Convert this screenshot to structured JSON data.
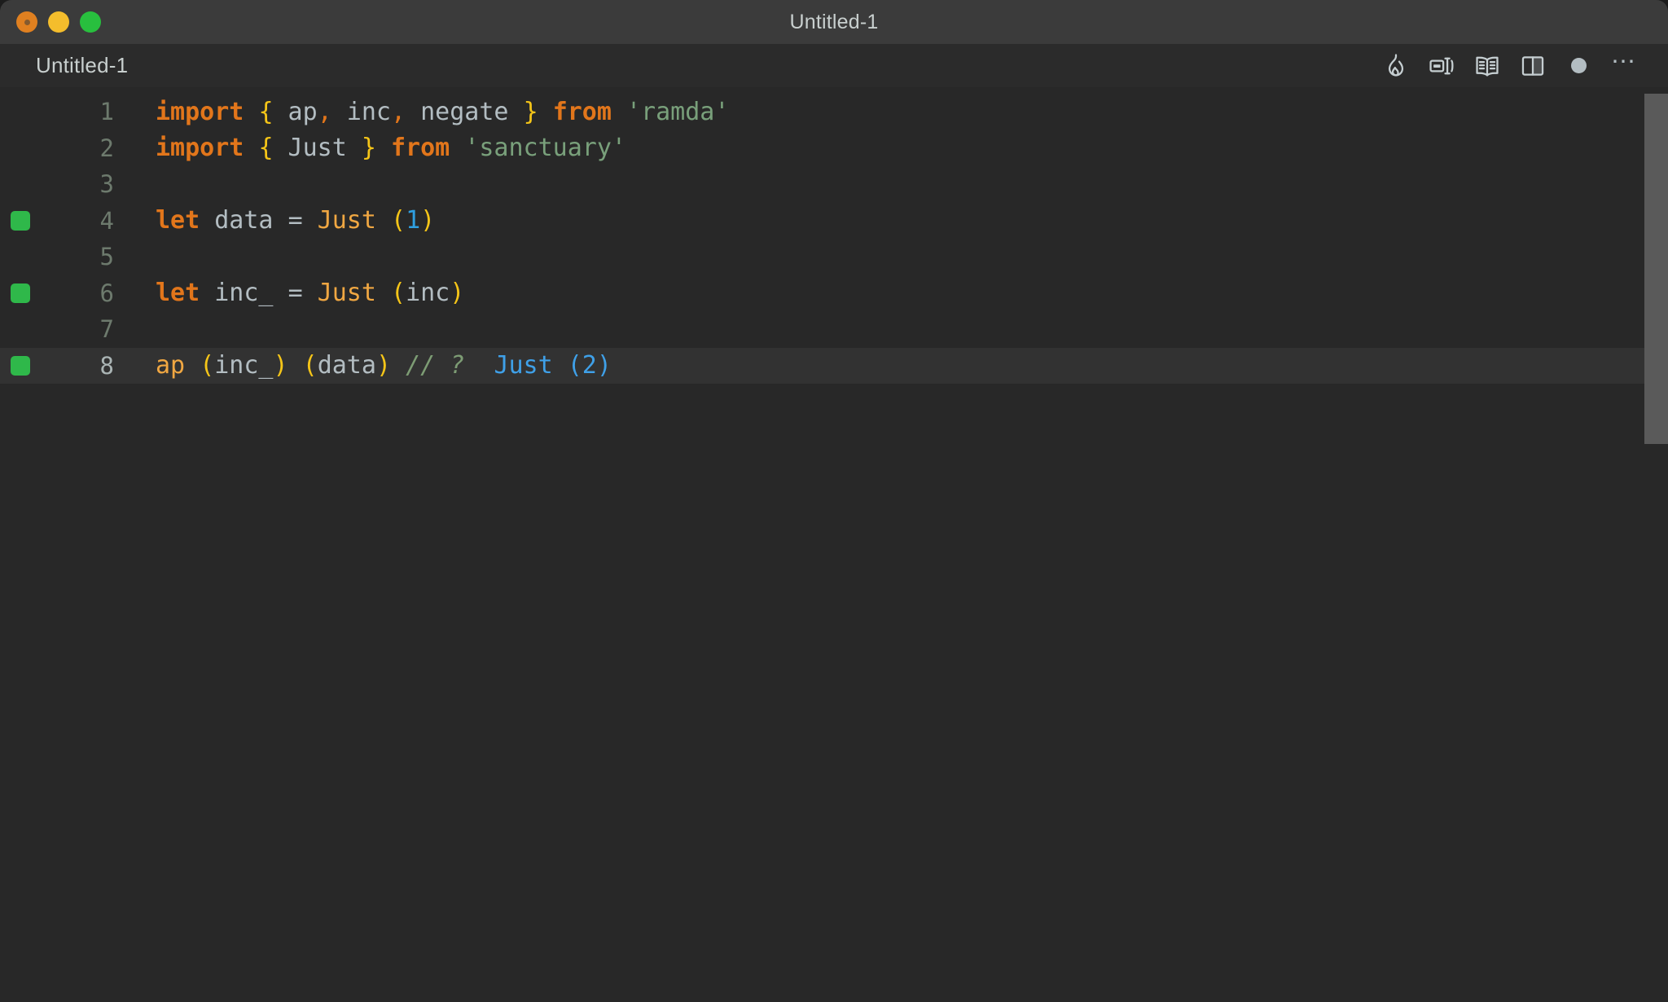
{
  "window": {
    "title": "Untitled-1",
    "traffic_lights": [
      {
        "name": "close-button",
        "color": "#e08020"
      },
      {
        "name": "minimize-button",
        "color": "#f4bd2c"
      },
      {
        "name": "zoom-button",
        "color": "#28bf3e"
      }
    ]
  },
  "tabbar": {
    "tab_label": "Untitled-1",
    "tools": [
      {
        "name": "flame-icon",
        "label": "Quokka / Run"
      },
      {
        "name": "rename-icon",
        "label": "Rename Symbol"
      },
      {
        "name": "book-icon",
        "label": "Open Docs"
      },
      {
        "name": "split-editor-icon",
        "label": "Split Editor"
      },
      {
        "name": "status-dot-icon",
        "label": "Unsaved changes"
      },
      {
        "name": "more-actions-icon",
        "label": "More Actions"
      }
    ]
  },
  "editor": {
    "language": "javascript",
    "active_line": 8,
    "lines": [
      {
        "number": "1",
        "marker": false,
        "tokens": [
          {
            "t": "import",
            "c": "kw"
          },
          {
            "t": " ",
            "c": "op"
          },
          {
            "t": "{",
            "c": "punc"
          },
          {
            "t": " ap",
            "c": "ident"
          },
          {
            "t": ",",
            "c": "comma"
          },
          {
            "t": " inc",
            "c": "ident"
          },
          {
            "t": ",",
            "c": "comma"
          },
          {
            "t": " negate ",
            "c": "ident"
          },
          {
            "t": "}",
            "c": "punc"
          },
          {
            "t": " ",
            "c": "op"
          },
          {
            "t": "from",
            "c": "kw"
          },
          {
            "t": " ",
            "c": "op"
          },
          {
            "t": "'ramda'",
            "c": "str"
          }
        ]
      },
      {
        "number": "2",
        "marker": false,
        "tokens": [
          {
            "t": "import",
            "c": "kw"
          },
          {
            "t": " ",
            "c": "op"
          },
          {
            "t": "{",
            "c": "punc"
          },
          {
            "t": " Just ",
            "c": "ident"
          },
          {
            "t": "}",
            "c": "punc"
          },
          {
            "t": " ",
            "c": "op"
          },
          {
            "t": "from",
            "c": "kw"
          },
          {
            "t": " ",
            "c": "op"
          },
          {
            "t": "'sanctuary'",
            "c": "str"
          }
        ]
      },
      {
        "number": "3",
        "marker": false,
        "tokens": []
      },
      {
        "number": "4",
        "marker": true,
        "tokens": [
          {
            "t": "let",
            "c": "kw"
          },
          {
            "t": " data ",
            "c": "ident"
          },
          {
            "t": "=",
            "c": "op"
          },
          {
            "t": " ",
            "c": "op"
          },
          {
            "t": "Just",
            "c": "ctor"
          },
          {
            "t": " ",
            "c": "op"
          },
          {
            "t": "(",
            "c": "punc"
          },
          {
            "t": "1",
            "c": "num"
          },
          {
            "t": ")",
            "c": "punc"
          }
        ]
      },
      {
        "number": "5",
        "marker": false,
        "tokens": []
      },
      {
        "number": "6",
        "marker": true,
        "tokens": [
          {
            "t": "let",
            "c": "kw"
          },
          {
            "t": " inc_ ",
            "c": "ident"
          },
          {
            "t": "=",
            "c": "op"
          },
          {
            "t": " ",
            "c": "op"
          },
          {
            "t": "Just",
            "c": "ctor"
          },
          {
            "t": " ",
            "c": "op"
          },
          {
            "t": "(",
            "c": "punc"
          },
          {
            "t": "inc",
            "c": "ident"
          },
          {
            "t": ")",
            "c": "punc"
          }
        ]
      },
      {
        "number": "7",
        "marker": false,
        "tokens": []
      },
      {
        "number": "8",
        "marker": true,
        "tokens": [
          {
            "t": "ap",
            "c": "fn"
          },
          {
            "t": " ",
            "c": "op"
          },
          {
            "t": "(",
            "c": "punc"
          },
          {
            "t": "inc_",
            "c": "ident"
          },
          {
            "t": ")",
            "c": "punc"
          },
          {
            "t": " ",
            "c": "op"
          },
          {
            "t": "(",
            "c": "punc"
          },
          {
            "t": "data",
            "c": "ident"
          },
          {
            "t": ")",
            "c": "punc"
          },
          {
            "t": " ",
            "c": "op"
          },
          {
            "t": "// ?",
            "c": "comment"
          },
          {
            "t": "  ",
            "c": "op"
          },
          {
            "t": "Just (2)",
            "c": "result"
          }
        ]
      }
    ]
  },
  "scrollbar": {
    "name": "vertical-scrollbar",
    "thumb_color": "#5a5a5a"
  },
  "theme": {
    "titlebar_bg": "#3b3b3b",
    "tabbar_bg": "#2b2b2b",
    "editor_bg": "#282828",
    "active_line_bg": "#323232",
    "marker_green": "#2fb84a",
    "keyword_orange": "#e2761b",
    "punct_yellow": "#f5c518",
    "string_green": "#79a07b",
    "identifier_gray": "#b3bdc2",
    "number_blue": "#2f9fe0",
    "comment_green": "#7d9c74",
    "result_blue": "#3fa0e8"
  }
}
